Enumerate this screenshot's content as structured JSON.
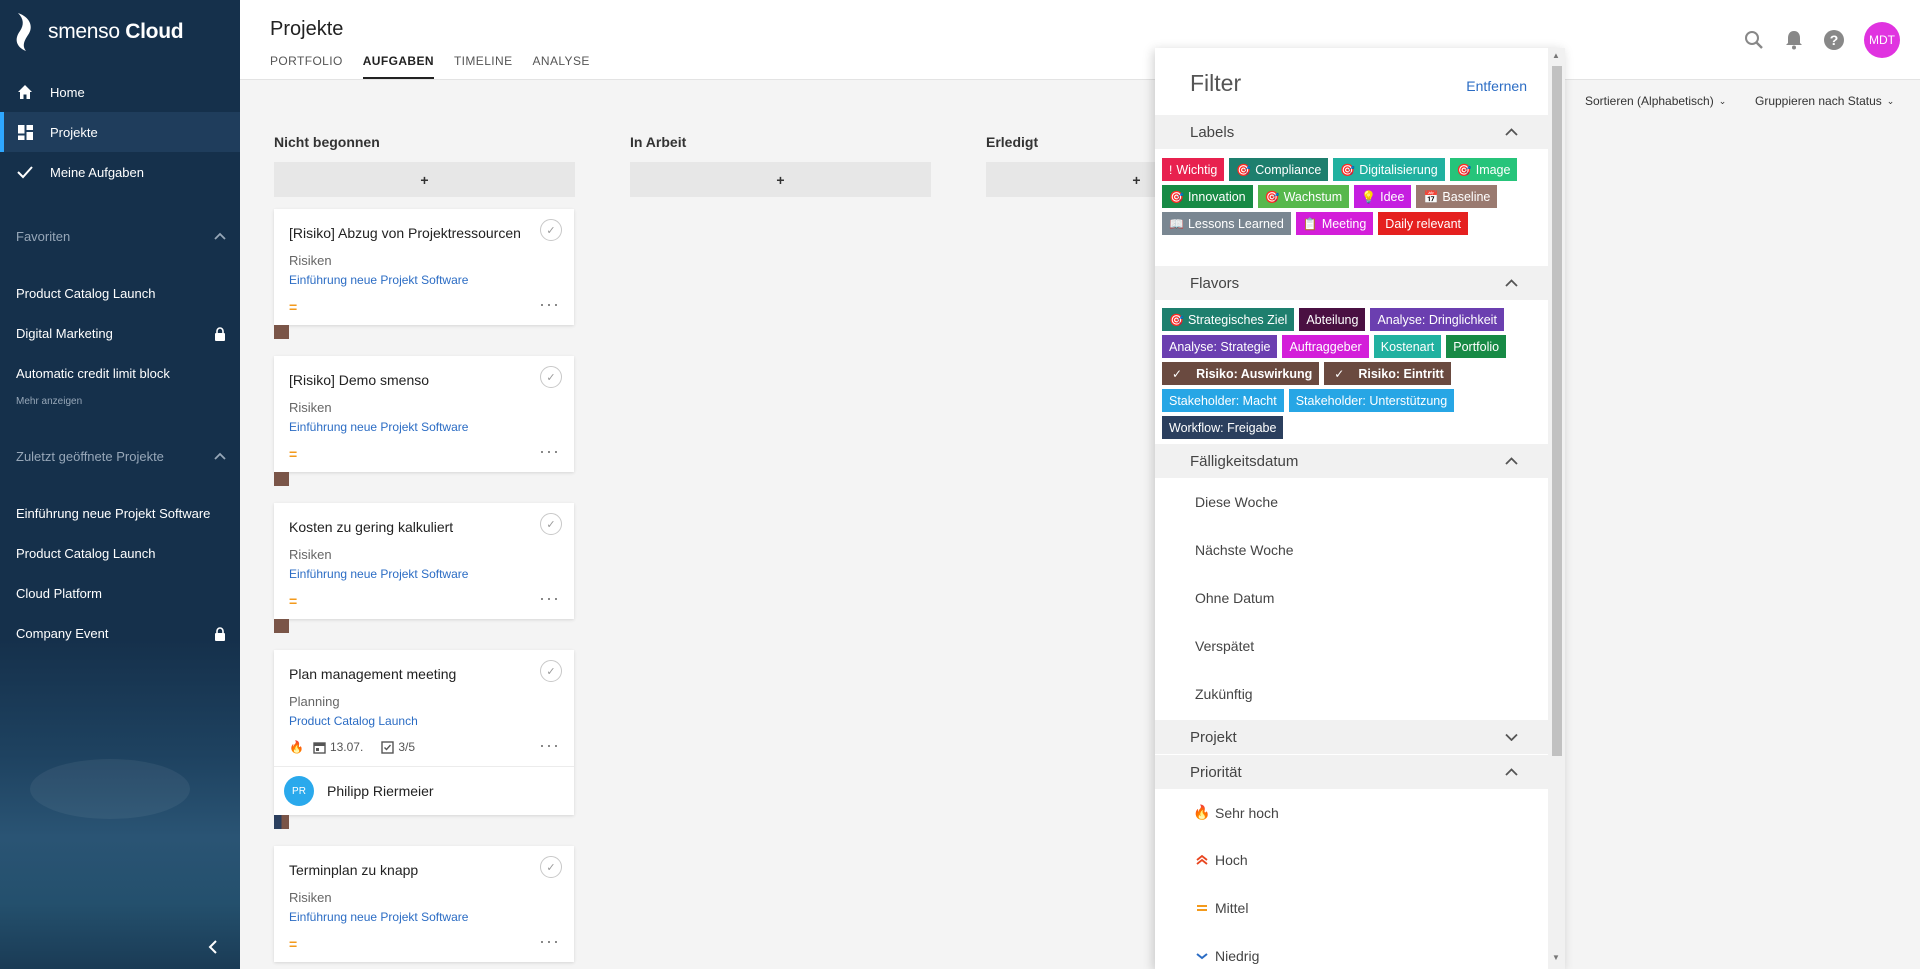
{
  "app": {
    "brand_light": "smenso",
    "brand_bold": "Cloud"
  },
  "sidebar": {
    "nav": [
      {
        "label": "Home",
        "icon": "home-icon"
      },
      {
        "label": "Projekte",
        "icon": "dashboard-icon"
      },
      {
        "label": "Meine Aufgaben",
        "icon": "check-icon"
      }
    ],
    "favorites_title": "Favoriten",
    "favorites": [
      {
        "label": "Product Catalog Launch",
        "locked": false
      },
      {
        "label": "Digital Marketing",
        "locked": true
      },
      {
        "label": "Automatic credit limit block",
        "locked": false
      }
    ],
    "more_label": "Mehr anzeigen",
    "recent_title": "Zuletzt geöffnete Projekte",
    "recent": [
      {
        "label": "Einführung neue Projekt Software",
        "locked": false
      },
      {
        "label": "Product Catalog Launch",
        "locked": false
      },
      {
        "label": "Cloud Platform",
        "locked": false
      },
      {
        "label": "Company Event",
        "locked": true
      }
    ]
  },
  "header": {
    "title": "Projekte",
    "tabs": [
      "PORTFOLIO",
      "AUFGABEN",
      "TIMELINE",
      "ANALYSE"
    ],
    "active_tab": "AUFGABEN",
    "avatar": "MDT"
  },
  "toolbar": {
    "sort": "Sortieren (Alphabetisch)",
    "group": "Gruppieren nach Status"
  },
  "board": {
    "columns": [
      "Nicht begonnen",
      "In Arbeit",
      "Erledigt"
    ],
    "add_label": "+",
    "cards": [
      {
        "title": "[Risiko] Abzug von Projektressourcen",
        "category": "Risiken",
        "project": "Einführung neue Projekt Software",
        "priority": "=",
        "swatch": "#7a5548"
      },
      {
        "title": "[Risiko] Demo smenso",
        "category": "Risiken",
        "project": "Einführung neue Projekt Software",
        "priority": "=",
        "swatch": "#7a5548"
      },
      {
        "title": "Kosten zu gering kalkuliert",
        "category": "Risiken",
        "project": "Einführung neue Projekt Software",
        "priority": "=",
        "swatch": "#7a5548"
      },
      {
        "title": "Plan management meeting",
        "category": "Planning",
        "project": "Product Catalog Launch",
        "date": "13.07.",
        "subtasks": "3/5",
        "assignee_initials": "PR",
        "assignee_name": "Philipp Riermeier"
      },
      {
        "title": "Terminplan zu knapp",
        "category": "Risiken",
        "project": "Einführung neue Projekt Software",
        "priority": "="
      }
    ]
  },
  "filter": {
    "title": "Filter",
    "remove": "Entfernen",
    "sections": {
      "labels": "Labels",
      "flavors": "Flavors",
      "due": "Fälligkeitsdatum",
      "project": "Projekt",
      "priority": "Priorität"
    },
    "labels": [
      {
        "label": "Wichtig",
        "icon": "!",
        "color": "#e8214f"
      },
      {
        "label": "Compliance",
        "icon": "🎯",
        "color": "#1e7f6e"
      },
      {
        "label": "Digitalisierung",
        "icon": "🎯",
        "color": "#21b1a0"
      },
      {
        "label": "Image",
        "icon": "🎯",
        "color": "#26c47a"
      },
      {
        "label": "Innovation",
        "icon": "🎯",
        "color": "#178a45"
      },
      {
        "label": "Wachstum",
        "icon": "🎯",
        "color": "#57b84c"
      },
      {
        "label": "Idee",
        "icon": "💡",
        "color": "#c51ee0"
      },
      {
        "label": "Baseline",
        "icon": "📅",
        "color": "#9a7a70"
      },
      {
        "label": "Lessons Learned",
        "icon": "📖",
        "color": "#7a8792"
      },
      {
        "label": "Meeting",
        "icon": "📋",
        "color": "#d31ed9"
      },
      {
        "label": "Daily relevant",
        "icon": "",
        "color": "#e5201f"
      }
    ],
    "flavors": [
      {
        "label": "Strategisches Ziel",
        "icon": "🎯",
        "color": "#1e7f6e",
        "selected": false
      },
      {
        "label": "Abteilung",
        "icon": "",
        "color": "#4a1042",
        "selected": false
      },
      {
        "label": "Analyse: Dringlichkeit",
        "icon": "",
        "color": "#6b3fb0",
        "selected": false
      },
      {
        "label": "Analyse: Strategie",
        "icon": "",
        "color": "#6b3fb0",
        "selected": false
      },
      {
        "label": "Auftraggeber",
        "icon": "",
        "color": "#d31ed9",
        "selected": false
      },
      {
        "label": "Kostenart",
        "icon": "",
        "color": "#21b1a0",
        "selected": false
      },
      {
        "label": "Portfolio",
        "icon": "",
        "color": "#178a45",
        "selected": false
      },
      {
        "label": "Risiko: Auswirkung",
        "icon": "✓",
        "color": "#6a4a40",
        "selected": true
      },
      {
        "label": "Risiko: Eintritt",
        "icon": "✓",
        "color": "#6a4a40",
        "selected": true
      },
      {
        "label": "Stakeholder: Macht",
        "icon": "",
        "color": "#27a6e5",
        "selected": false
      },
      {
        "label": "Stakeholder: Unterstützung",
        "icon": "",
        "color": "#27a6e5",
        "selected": false
      },
      {
        "label": "Workflow: Freigabe",
        "icon": "",
        "color": "#2b3f5e",
        "selected": false
      }
    ],
    "due_options": [
      "Diese Woche",
      "Nächste Woche",
      "Ohne Datum",
      "Verspätet",
      "Zukünftig"
    ],
    "priorities": [
      {
        "label": "Sehr hoch",
        "icon": "🔥",
        "color": "#e8451f"
      },
      {
        "label": "Hoch",
        "icon": "≈",
        "color": "#e8451f"
      },
      {
        "label": "Mittel",
        "icon": "=",
        "color": "#f39a1c"
      },
      {
        "label": "Niedrig",
        "icon": "⌄",
        "color": "#2b6cc4"
      }
    ]
  }
}
